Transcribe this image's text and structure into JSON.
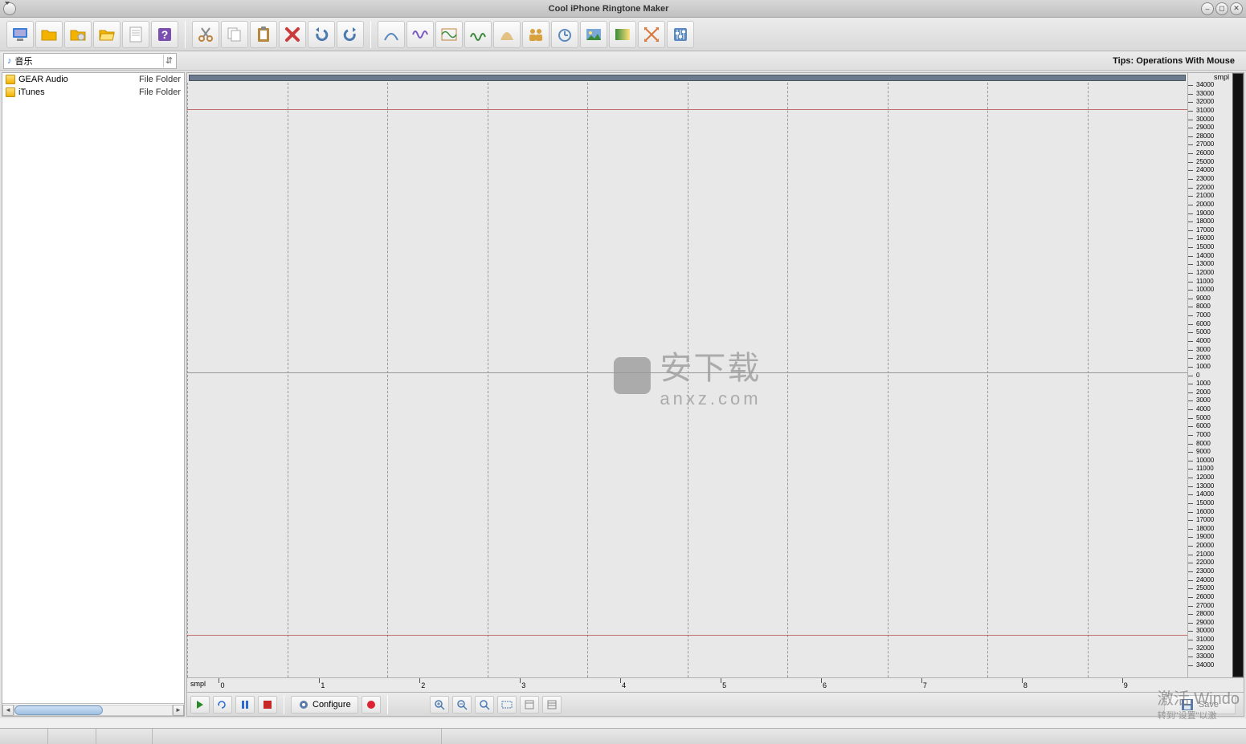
{
  "window": {
    "title": "Cool iPhone Ringtone Maker"
  },
  "toolbar_left": [
    "computer",
    "open-folder",
    "cd",
    "folder-open",
    "sheet",
    "help"
  ],
  "toolbar_edit": [
    "cut",
    "copy",
    "paste",
    "delete",
    "undo",
    "redo"
  ],
  "toolbar_fx": [
    "fade",
    "wave",
    "osc",
    "wave2",
    "bell",
    "people",
    "timer",
    "picture",
    "gradient",
    "arrows",
    "sliders"
  ],
  "path": {
    "label": "音乐"
  },
  "tips": "Tips: Operations With Mouse",
  "files": [
    {
      "name": "GEAR Audio",
      "type": "File Folder"
    },
    {
      "name": "iTunes",
      "type": "File Folder"
    }
  ],
  "amp_unit": "smpl",
  "time_unit": "smpl",
  "time_ticks": [
    0,
    1,
    2,
    3,
    4,
    5,
    6,
    7,
    8,
    9
  ],
  "amp_ticks": [
    34000,
    33000,
    32000,
    31000,
    30000,
    29000,
    28000,
    27000,
    26000,
    25000,
    24000,
    23000,
    22000,
    21000,
    20000,
    19000,
    18000,
    17000,
    16000,
    15000,
    14000,
    13000,
    12000,
    11000,
    10000,
    9000,
    8000,
    7000,
    6000,
    5000,
    4000,
    3000,
    2000,
    1000,
    0,
    1000,
    2000,
    3000,
    4000,
    5000,
    6000,
    7000,
    8000,
    9000,
    10000,
    11000,
    12000,
    13000,
    14000,
    15000,
    16000,
    17000,
    18000,
    19000,
    20000,
    21000,
    22000,
    23000,
    24000,
    25000,
    26000,
    27000,
    28000,
    29000,
    30000,
    31000,
    32000,
    33000,
    34000
  ],
  "watermark": {
    "line1": "安下载",
    "line2": "anxz.com"
  },
  "transport": {
    "configure": "Configure"
  },
  "save_label": "Save",
  "activation": {
    "line1": "激活 Windo",
    "line2": "转到\"设置\"以激"
  }
}
